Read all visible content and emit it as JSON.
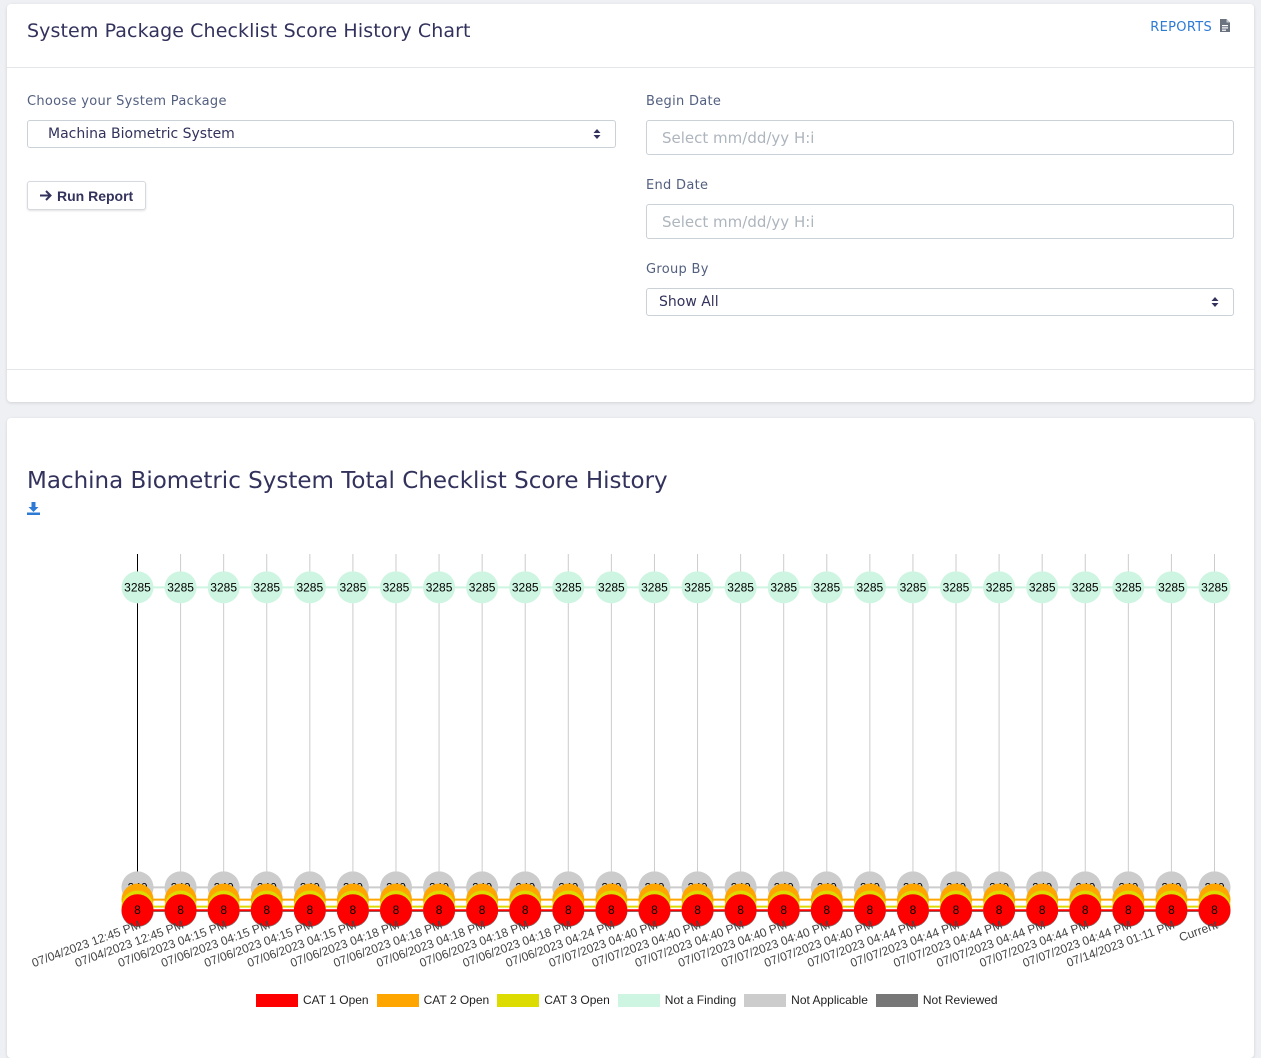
{
  "header": {
    "title": "System Package Checklist Score History Chart",
    "reports_link": "REPORTS",
    "reports_icon": "file-icon"
  },
  "form": {
    "package_label": "Choose your System Package",
    "package_value": "Machina Biometric System",
    "run_button": "Run Report",
    "begin_label": "Begin Date",
    "begin_placeholder": "Select mm/dd/yy H:i",
    "end_label": "End Date",
    "end_placeholder": "Select mm/dd/yy H:i",
    "group_label": "Group By",
    "group_value": "Show All"
  },
  "chart_data": {
    "type": "line",
    "title": "Machina Biometric System Total Checklist Score History",
    "categories": [
      "07/04/2023 12:45 PM",
      "07/04/2023 12:45 PM",
      "07/06/2023 04:15 PM",
      "07/06/2023 04:15 PM",
      "07/06/2023 04:15 PM",
      "07/06/2023 04:15 PM",
      "07/06/2023 04:18 PM",
      "07/06/2023 04:18 PM",
      "07/06/2023 04:18 PM",
      "07/06/2023 04:18 PM",
      "07/06/2023 04:18 PM",
      "07/06/2023 04:24 PM",
      "07/07/2023 04:40 PM",
      "07/07/2023 04:40 PM",
      "07/07/2023 04:40 PM",
      "07/07/2023 04:40 PM",
      "07/07/2023 04:40 PM",
      "07/07/2023 04:40 PM",
      "07/07/2023 04:44 PM",
      "07/07/2023 04:44 PM",
      "07/07/2023 04:44 PM",
      "07/07/2023 04:44 PM",
      "07/07/2023 04:44 PM",
      "07/07/2023 04:44 PM",
      "07/14/2023 01:11 PM",
      "Current"
    ],
    "series": [
      {
        "name": "CAT 1 Open",
        "color": "#ff0000",
        "values": [
          8,
          8,
          8,
          8,
          8,
          8,
          8,
          8,
          8,
          8,
          8,
          8,
          8,
          8,
          8,
          8,
          8,
          8,
          8,
          8,
          8,
          8,
          8,
          8,
          8,
          8
        ]
      },
      {
        "name": "CAT 2 Open",
        "color": "#ffa500",
        "values": [
          115,
          115,
          115,
          115,
          115,
          115,
          115,
          115,
          115,
          115,
          115,
          115,
          116,
          116,
          116,
          116,
          116,
          116,
          116,
          116,
          116,
          116,
          116,
          116,
          116,
          116
        ]
      },
      {
        "name": "CAT 3 Open",
        "color": "#dcdc00",
        "values": [
          45,
          45,
          45,
          45,
          45,
          45,
          45,
          45,
          45,
          45,
          45,
          45,
          45,
          45,
          45,
          45,
          45,
          45,
          45,
          45,
          45,
          45,
          45,
          45,
          45,
          45
        ]
      },
      {
        "name": "Not a Finding",
        "color": "#cdf5e2",
        "values": [
          3285,
          3285,
          3285,
          3285,
          3285,
          3285,
          3285,
          3285,
          3285,
          3285,
          3285,
          3285,
          3285,
          3285,
          3285,
          3285,
          3285,
          3285,
          3285,
          3285,
          3285,
          3285,
          3285,
          3285,
          3285,
          3285
        ]
      },
      {
        "name": "Not Applicable",
        "color": "#cccccc",
        "values": [
          240,
          240,
          240,
          240,
          240,
          240,
          240,
          240,
          240,
          240,
          240,
          240,
          240,
          240,
          240,
          240,
          240,
          240,
          240,
          240,
          240,
          240,
          240,
          240,
          240,
          240
        ]
      },
      {
        "name": "Not Reviewed",
        "color": "#777777",
        "values": [
          0,
          0,
          0,
          0,
          0,
          0,
          0,
          0,
          0,
          0,
          0,
          0,
          0,
          0,
          0,
          0,
          0,
          0,
          0,
          0,
          0,
          0,
          0,
          0,
          0,
          0
        ]
      }
    ],
    "legend_position": "bottom"
  }
}
